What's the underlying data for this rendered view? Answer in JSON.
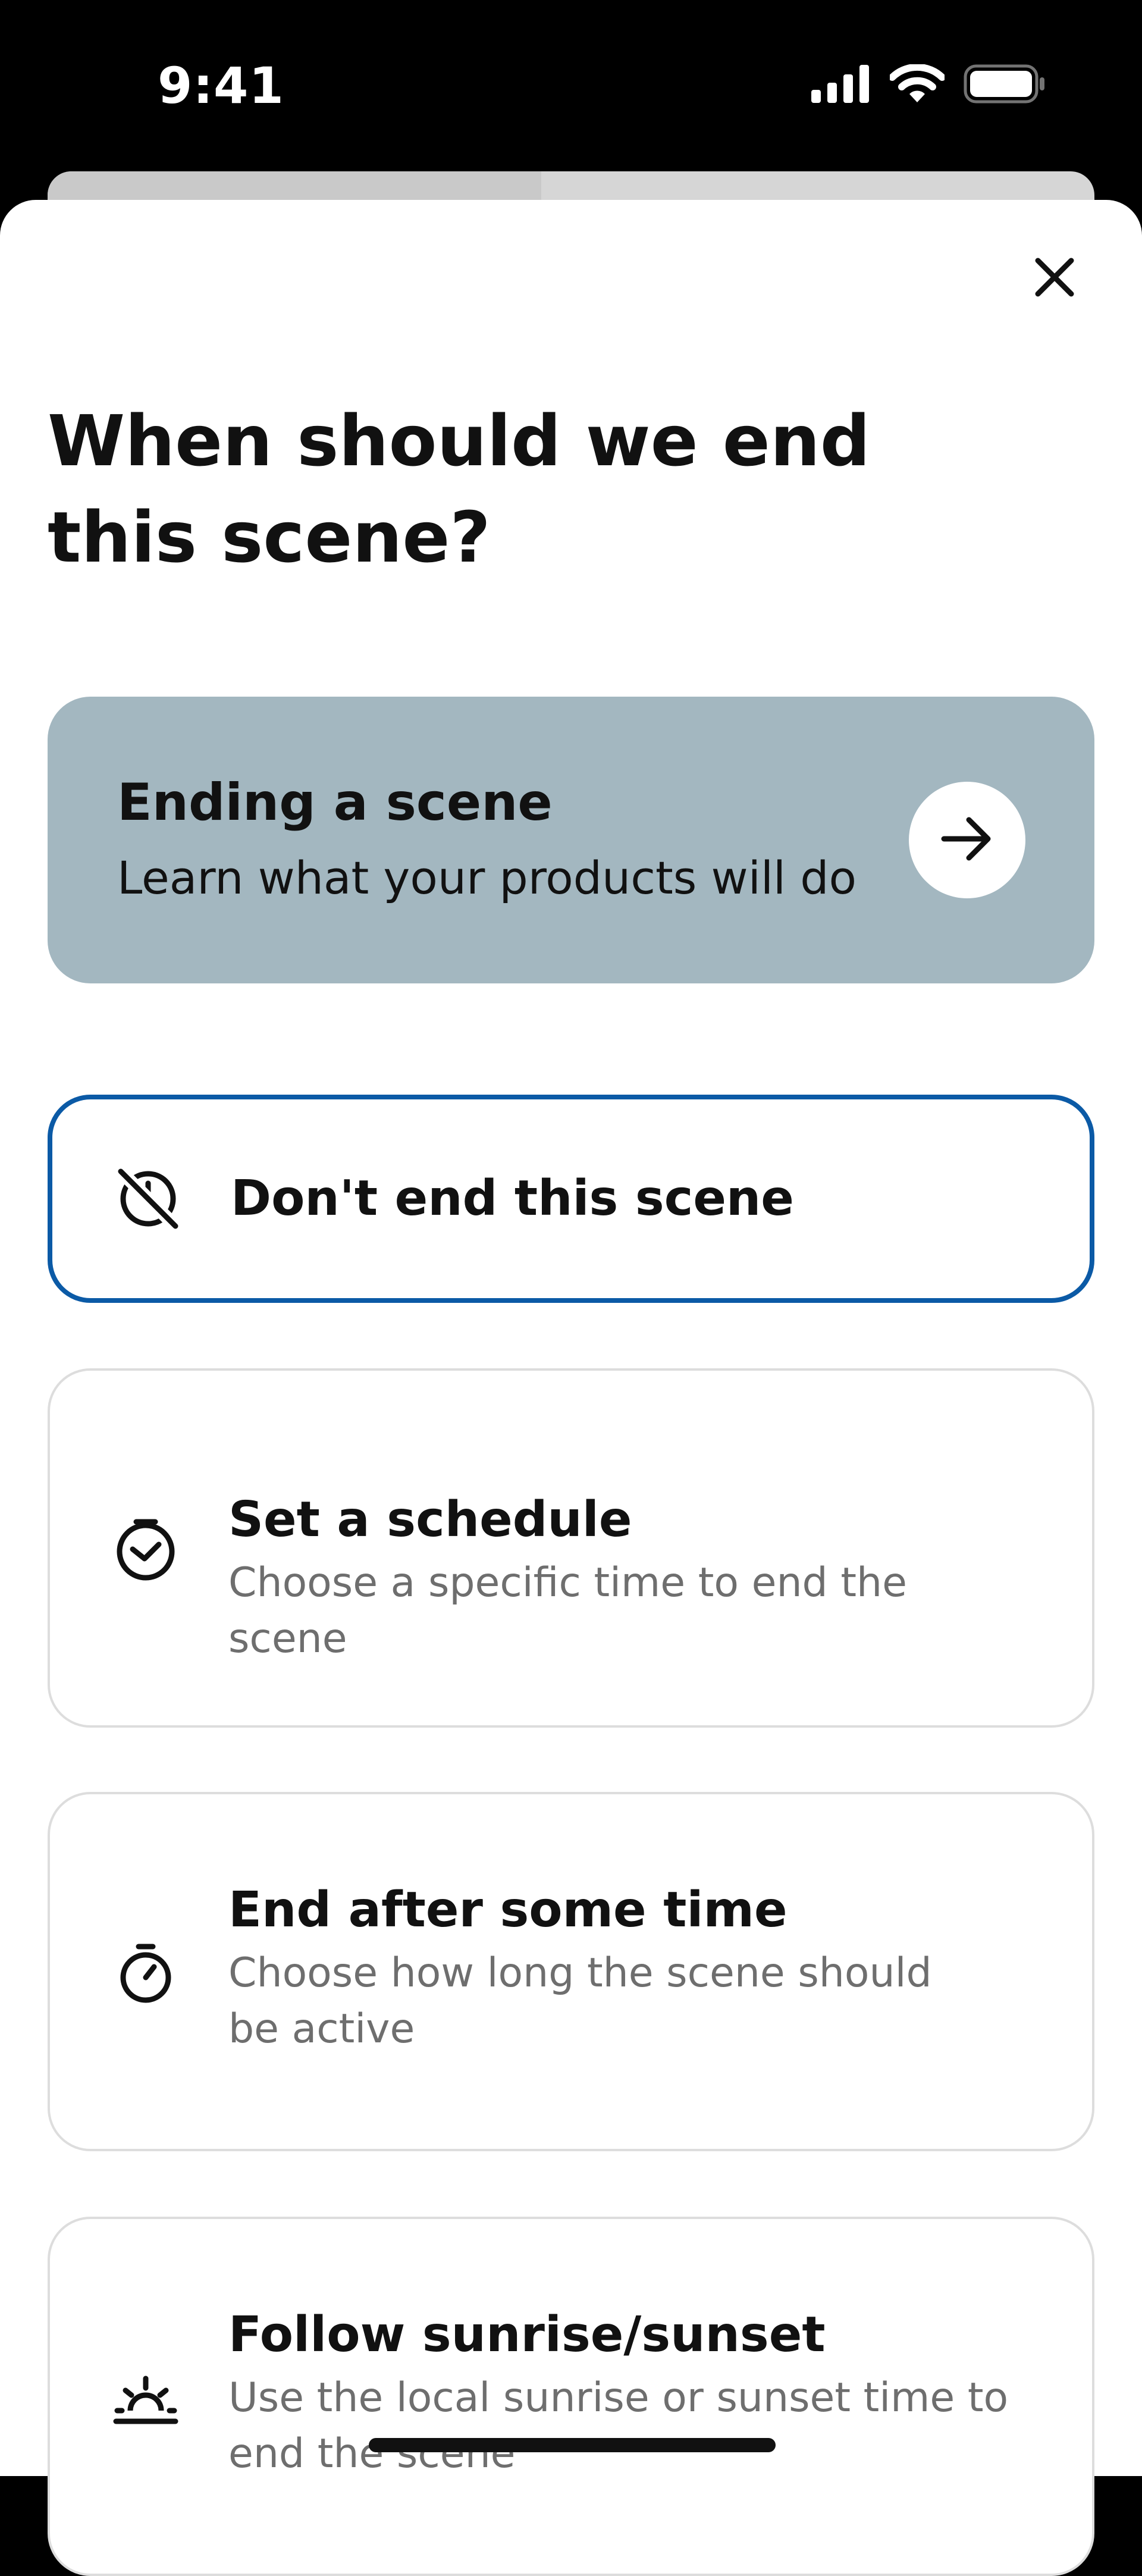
{
  "status_bar": {
    "time": "9:41",
    "icons": [
      "signal-icon",
      "wifi-icon",
      "battery-icon"
    ]
  },
  "sheet": {
    "close_icon": "close-icon",
    "title": "When should we end this scene?"
  },
  "info_card": {
    "title": "Ending a scene",
    "subtitle": "Learn what your products will do",
    "icon": "arrow-right-icon",
    "background": "#a3b7c0"
  },
  "options": [
    {
      "label": "Don't end this scene",
      "description": "",
      "icon": "no-end-icon",
      "selected": true
    },
    {
      "label": "Set a schedule",
      "description": "Choose a specific time to end the scene",
      "icon": "clock-icon",
      "selected": false
    },
    {
      "label": "End after some time",
      "description": "Choose how long the scene should be active",
      "icon": "timer-icon",
      "selected": false
    },
    {
      "label": "Follow sunrise/sunset",
      "description": "Use the local sunrise or sunset time to end the scene",
      "icon": "sunset-icon",
      "selected": false
    }
  ],
  "colors": {
    "selected_border": "#0b5aa6",
    "card_border": "#dddddd",
    "description_text": "#6e6e6e"
  }
}
